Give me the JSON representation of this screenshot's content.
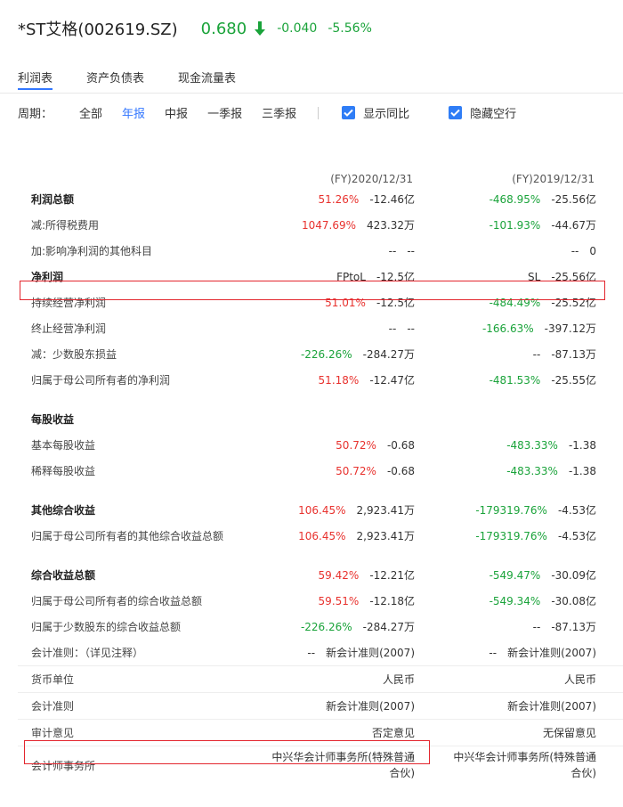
{
  "header": {
    "stock_name": "*ST艾格(002619.SZ)",
    "price": "0.680",
    "change": "-0.040",
    "change_pct": "-5.56%",
    "price_color": "#1aa33a"
  },
  "tabs": [
    "利润表",
    "资产负债表",
    "现金流量表"
  ],
  "filters": {
    "period_label": "周期：",
    "options": [
      "全部",
      "年报",
      "中报",
      "一季报",
      "三季报"
    ],
    "active": "年报",
    "checkboxes": [
      "显示同比",
      "隐藏空行"
    ]
  },
  "columns": [
    "(FY)2020/12/31",
    "(FY)2019/12/31"
  ],
  "rows": [
    {
      "name": "利润总额",
      "bold": true,
      "c1": {
        "pct": "51.26%",
        "pc": "red",
        "val": "-12.46亿"
      },
      "c2": {
        "pct": "-468.95%",
        "pc": "green",
        "val": "-25.56亿"
      }
    },
    {
      "name": "减:所得税费用",
      "c1": {
        "pct": "1047.69%",
        "pc": "red",
        "val": "423.32万"
      },
      "c2": {
        "pct": "-101.93%",
        "pc": "green",
        "val": "-44.67万"
      }
    },
    {
      "name": "加:影响净利润的其他科目",
      "c1": {
        "pct": "--",
        "pc": "",
        "val": "--"
      },
      "c2": {
        "pct": "--",
        "pc": "",
        "val": "0"
      }
    },
    {
      "name": "净利润",
      "bold": true,
      "c1": {
        "pct": "FPtoL",
        "pc": "",
        "val": "-12.5亿"
      },
      "c2": {
        "pct": "SL",
        "pc": "",
        "val": "-25.56亿"
      }
    },
    {
      "name": "持续经营净利润",
      "c1": {
        "pct": "51.01%",
        "pc": "red",
        "val": "-12.5亿"
      },
      "c2": {
        "pct": "-484.49%",
        "pc": "green",
        "val": "-25.52亿"
      }
    },
    {
      "name": "终止经营净利润",
      "c1": {
        "pct": "--",
        "pc": "",
        "val": "--"
      },
      "c2": {
        "pct": "-166.63%",
        "pc": "green",
        "val": "-397.12万"
      }
    },
    {
      "name": "减：少数股东损益",
      "c1": {
        "pct": "-226.26%",
        "pc": "green",
        "val": "-284.27万"
      },
      "c2": {
        "pct": "--",
        "pc": "",
        "val": "-87.13万"
      }
    },
    {
      "name": "归属于母公司所有者的净利润",
      "c1": {
        "pct": "51.18%",
        "pc": "red",
        "val": "-12.47亿"
      },
      "c2": {
        "pct": "-481.53%",
        "pc": "green",
        "val": "-25.55亿"
      }
    },
    {
      "name": "每股收益",
      "bold": true,
      "c1": {
        "pct": "",
        "pc": "",
        "val": ""
      },
      "c2": {
        "pct": "",
        "pc": "",
        "val": ""
      }
    },
    {
      "name": "基本每股收益",
      "c1": {
        "pct": "50.72%",
        "pc": "red",
        "val": "-0.68"
      },
      "c2": {
        "pct": "-483.33%",
        "pc": "green",
        "val": "-1.38"
      }
    },
    {
      "name": "稀释每股收益",
      "c1": {
        "pct": "50.72%",
        "pc": "red",
        "val": "-0.68"
      },
      "c2": {
        "pct": "-483.33%",
        "pc": "green",
        "val": "-1.38"
      }
    },
    {
      "name": "其他综合收益",
      "bold": true,
      "c1": {
        "pct": "106.45%",
        "pc": "red",
        "val": "2,923.41万"
      },
      "c2": {
        "pct": "-179319.76%",
        "pc": "green",
        "val": "-4.53亿"
      }
    },
    {
      "name": "归属于母公司所有者的其他综合收益总额",
      "c1": {
        "pct": "106.45%",
        "pc": "red",
        "val": "2,923.41万"
      },
      "c2": {
        "pct": "-179319.76%",
        "pc": "green",
        "val": "-4.53亿"
      }
    },
    {
      "name": "综合收益总额",
      "bold": true,
      "c1": {
        "pct": "59.42%",
        "pc": "red",
        "val": "-12.21亿"
      },
      "c2": {
        "pct": "-549.47%",
        "pc": "green",
        "val": "-30.09亿"
      }
    },
    {
      "name": "归属于母公司所有者的综合收益总额",
      "c1": {
        "pct": "59.51%",
        "pc": "red",
        "val": "-12.18亿"
      },
      "c2": {
        "pct": "-549.34%",
        "pc": "green",
        "val": "-30.08亿"
      }
    },
    {
      "name": "归属于少数股东的综合收益总额",
      "c1": {
        "pct": "-226.26%",
        "pc": "green",
        "val": "-284.27万"
      },
      "c2": {
        "pct": "--",
        "pc": "",
        "val": "-87.13万"
      }
    },
    {
      "name": "会计准则：（详见注释）",
      "c1": {
        "pct": "--",
        "pc": "",
        "val": "新会计准则(2007)"
      },
      "c2": {
        "pct": "--",
        "pc": "",
        "val": "新会计准则(2007)"
      }
    },
    {
      "name": "货币单位",
      "boxed": true,
      "c1": {
        "pct": "",
        "pc": "",
        "val": "人民币"
      },
      "c2": {
        "pct": "",
        "pc": "",
        "val": "人民币"
      }
    },
    {
      "name": "会计准则",
      "boxed": true,
      "c1": {
        "pct": "",
        "pc": "",
        "val": "新会计准则(2007)"
      },
      "c2": {
        "pct": "",
        "pc": "",
        "val": "新会计准则(2007)"
      }
    },
    {
      "name": "审计意见",
      "boxed": true,
      "c1": {
        "pct": "",
        "pc": "",
        "val": "否定意见"
      },
      "c2": {
        "pct": "",
        "pc": "",
        "val": "无保留意见"
      }
    },
    {
      "name": "会计师事务所",
      "boxed": true,
      "tall": true,
      "c1": {
        "pct": "",
        "pc": "",
        "val": "中兴华会计师事务所(特殊普通合伙)"
      },
      "c2": {
        "pct": "",
        "pc": "",
        "val": "中兴华会计师事务所(特殊普通合伙)"
      }
    }
  ]
}
